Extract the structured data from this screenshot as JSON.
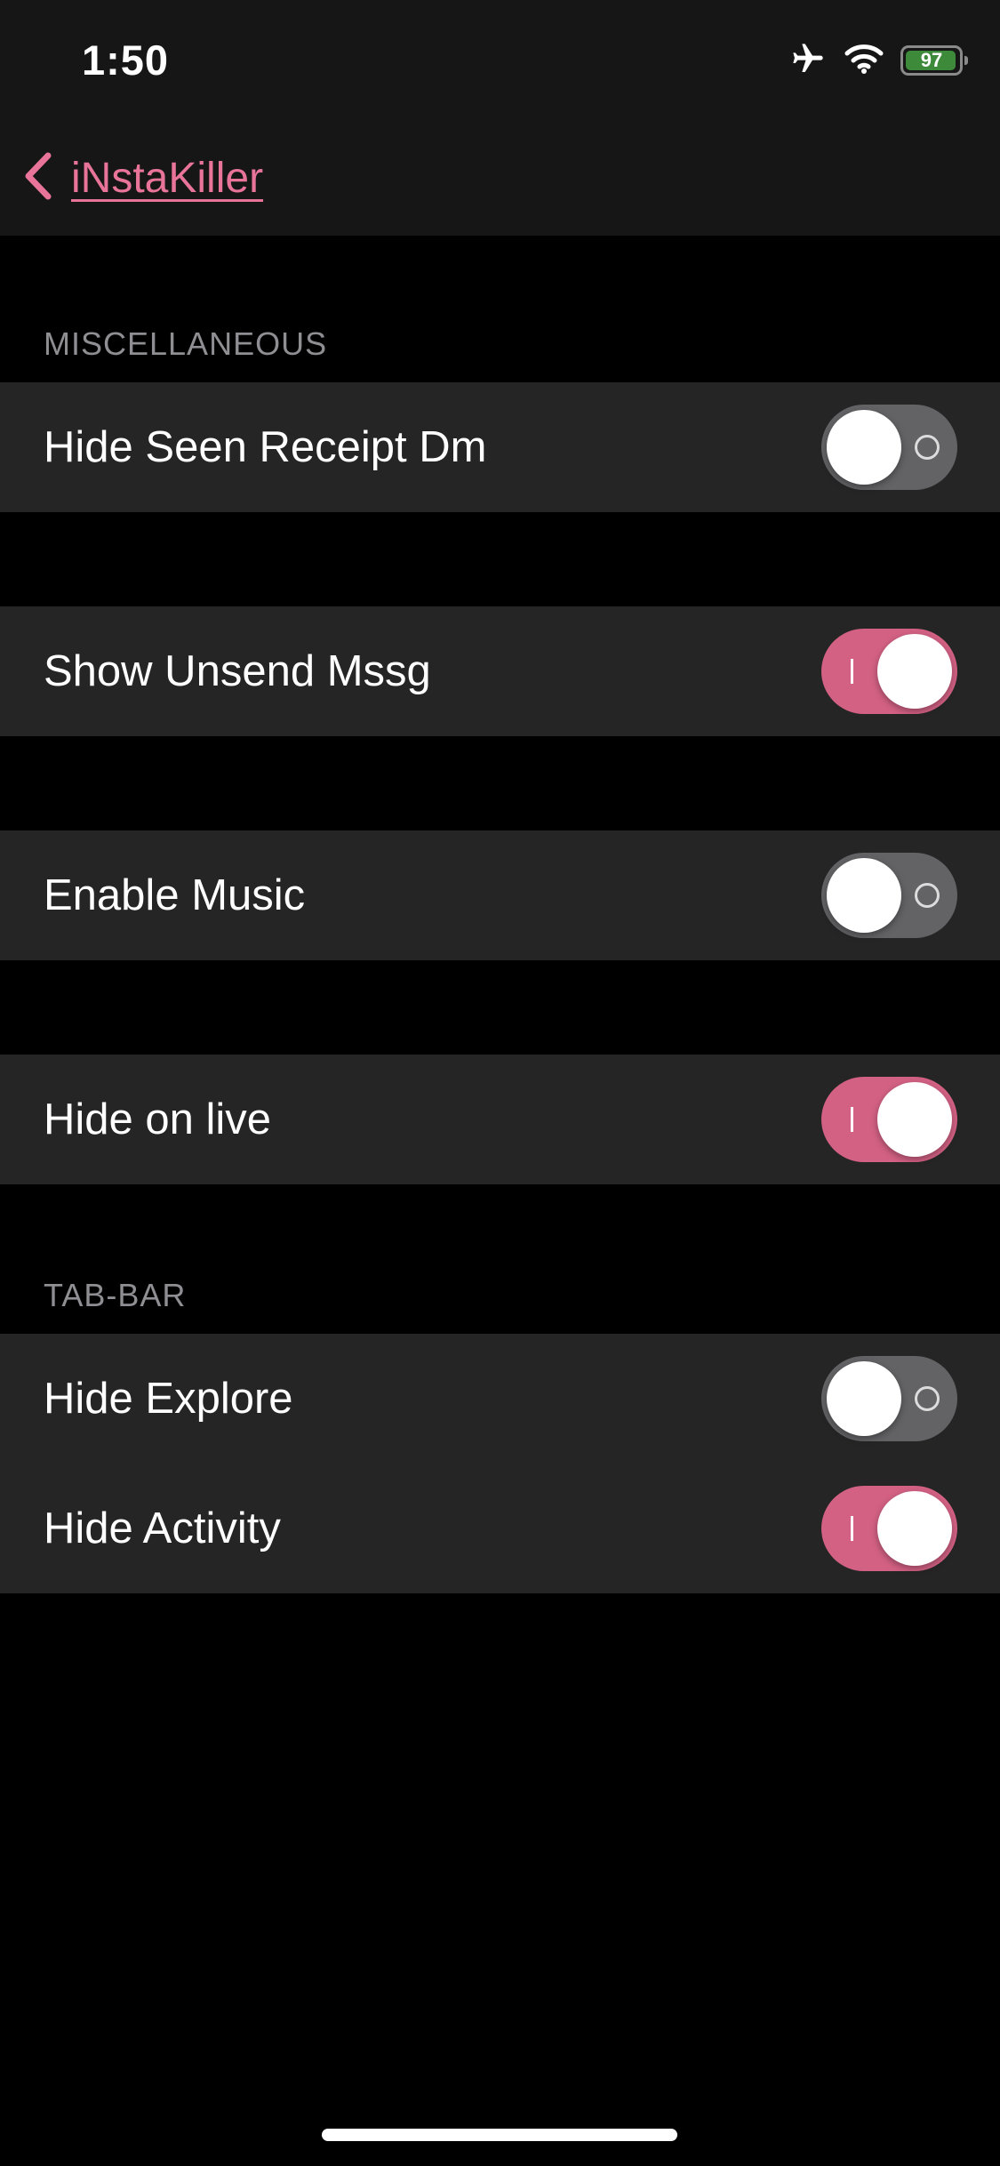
{
  "status_bar": {
    "time": "1:50",
    "battery_level": "97",
    "battery_fraction": 0.97,
    "icons": [
      "airplane-icon",
      "wifi-icon",
      "battery-icon"
    ]
  },
  "nav": {
    "back_label": "iNstaKiller",
    "accent_color": "#e8749a"
  },
  "sections": {
    "misc_header": "MISCELLANEOUS",
    "tabbar_header": "TAB-BAR"
  },
  "settings": {
    "hide_seen_receipt_dm": {
      "label": "Hide Seen Receipt Dm",
      "enabled": false
    },
    "show_unsend_mssg": {
      "label": "Show Unsend Mssg",
      "enabled": true
    },
    "enable_music": {
      "label": "Enable Music",
      "enabled": false
    },
    "hide_on_live": {
      "label": "Hide on live",
      "enabled": true
    },
    "hide_explore": {
      "label": "Hide Explore",
      "enabled": false
    },
    "hide_activity": {
      "label": "Hide Activity",
      "enabled": true
    }
  },
  "colors": {
    "toggle_on": "#d36184",
    "toggle_off": "#636366",
    "group_background": "#252525",
    "page_background": "#000000"
  }
}
